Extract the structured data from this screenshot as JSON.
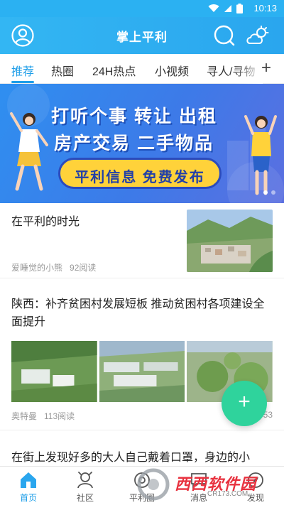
{
  "status_bar": {
    "time": "10:13"
  },
  "header": {
    "title": "掌上平利"
  },
  "tabs": [
    {
      "label": "推荐"
    },
    {
      "label": "热圈"
    },
    {
      "label": "24H热点"
    },
    {
      "label": "小视频"
    },
    {
      "label": "寻人/寻物"
    }
  ],
  "tabs_more_label": "+",
  "banner": {
    "line1": "打听个事 转让 出租",
    "line2": "房产交易 二手物品",
    "pill": "平利信息 免费发布"
  },
  "articles": [
    {
      "title": "在平利的时光",
      "author": "爱睡觉的小熊",
      "reads": "92阅读"
    },
    {
      "title": "陕西：补齐贫困村发展短板 推动贫困村各项建设全面提升",
      "author": "奥特曼",
      "reads": "113阅读",
      "time": "53"
    },
    {
      "title": "在街上发现好多的大人自己戴着口罩，身边的小"
    }
  ],
  "fab": {
    "label": "+"
  },
  "bottom_nav": [
    {
      "label": "首页"
    },
    {
      "label": "社区"
    },
    {
      "label": "平利圈"
    },
    {
      "label": "消息"
    },
    {
      "label": "发现"
    }
  ],
  "watermark": {
    "text": "西西软件园",
    "url": "CR173.COM"
  },
  "colors": {
    "accent": "#1e9ee8",
    "header": "#2bb1f2",
    "fab": "#2fd39c"
  }
}
